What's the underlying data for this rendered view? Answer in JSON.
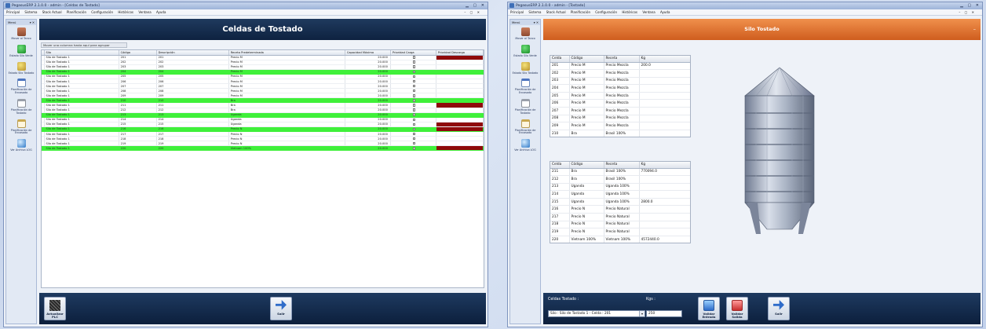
{
  "left_window": {
    "title": "PegasusERP 2.1.0.0 - admin - [Celdas de Tostado]",
    "menu": [
      "Principal",
      "Sistema",
      "Stock Actual",
      "Planificación",
      "Configuración",
      "Históricos",
      "Ventana",
      "Ayuda"
    ],
    "page_title": "Celdas de Tostado",
    "group_hint": "Mover una columna hasta aquí para agrupar",
    "columns": [
      "Silo",
      "Código",
      "Descripción",
      "Receta Predeterminada",
      "Capacidad Máxima",
      "Prioridad Carga",
      "Prioridad Descarga"
    ],
    "rows": [
      {
        "silo": "Silo de Tostado 1",
        "codigo": "201",
        "descripcion": "201",
        "receta": "Precio M",
        "cap": "20.000",
        "hl": false,
        "red": true
      },
      {
        "silo": "Silo de Tostado 1",
        "codigo": "202",
        "descripcion": "202",
        "receta": "Precio M",
        "cap": "20.000",
        "hl": false,
        "red": false
      },
      {
        "silo": "Silo de Tostado 1",
        "codigo": "203",
        "descripcion": "203",
        "receta": "Precio M",
        "cap": "20.000",
        "hl": false,
        "red": false
      },
      {
        "silo": "Silo de Tostado 1",
        "codigo": "204",
        "descripcion": "204",
        "receta": "Precio M",
        "cap": "20.000",
        "hl": true,
        "red": false
      },
      {
        "silo": "Silo de Tostado 1",
        "codigo": "205",
        "descripcion": "205",
        "receta": "Precio M",
        "cap": "20.000",
        "hl": false,
        "red": false
      },
      {
        "silo": "Silo de Tostado 1",
        "codigo": "206",
        "descripcion": "206",
        "receta": "Precio M",
        "cap": "20.000",
        "hl": false,
        "red": false
      },
      {
        "silo": "Silo de Tostado 1",
        "codigo": "207",
        "descripcion": "207",
        "receta": "Precio M",
        "cap": "20.000",
        "hl": false,
        "red": false
      },
      {
        "silo": "Silo de Tostado 1",
        "codigo": "208",
        "descripcion": "208",
        "receta": "Precio M",
        "cap": "20.000",
        "hl": false,
        "red": false
      },
      {
        "silo": "Silo de Tostado 1",
        "codigo": "209",
        "descripcion": "209",
        "receta": "Precio M",
        "cap": "20.000",
        "hl": false,
        "red": false
      },
      {
        "silo": "Silo de Tostado 1",
        "codigo": "210",
        "descripcion": "210",
        "receta": "Bra",
        "cap": "20.000",
        "hl": true,
        "red": false
      },
      {
        "silo": "Silo de Tostado 1",
        "codigo": "211",
        "descripcion": "211",
        "receta": "Bra",
        "cap": "20.000",
        "hl": false,
        "red": true
      },
      {
        "silo": "Silo de Tostado 1",
        "codigo": "212",
        "descripcion": "212",
        "receta": "Bra",
        "cap": "20.000",
        "hl": false,
        "red": false
      },
      {
        "silo": "Silo de Tostado 1",
        "codigo": "213",
        "descripcion": "213",
        "receta": "Uganda",
        "cap": "20.000",
        "hl": true,
        "red": false
      },
      {
        "silo": "Silo de Tostado 1",
        "codigo": "214",
        "descripcion": "214",
        "receta": "Uganda",
        "cap": "20.000",
        "hl": false,
        "red": false
      },
      {
        "silo": "Silo de Tostado 1",
        "codigo": "215",
        "descripcion": "215",
        "receta": "Uganda",
        "cap": "20.000",
        "hl": false,
        "red": true
      },
      {
        "silo": "Silo de Tostado 1",
        "codigo": "216",
        "descripcion": "216",
        "receta": "Precio N",
        "cap": "20.000",
        "hl": true,
        "red": true
      },
      {
        "silo": "Silo de Tostado 1",
        "codigo": "217",
        "descripcion": "217",
        "receta": "Precio N",
        "cap": "20.000",
        "hl": false,
        "red": false
      },
      {
        "silo": "Silo de Tostado 1",
        "codigo": "218",
        "descripcion": "218",
        "receta": "Precio N",
        "cap": "20.000",
        "hl": false,
        "red": false
      },
      {
        "silo": "Silo de Tostado 1",
        "codigo": "219",
        "descripcion": "219",
        "receta": "Precio N",
        "cap": "20.000",
        "hl": false,
        "red": false
      },
      {
        "silo": "Silo de Tostado 1",
        "codigo": "220",
        "descripcion": "220",
        "receta": "Vietnam 100%",
        "cap": "20.000",
        "hl": true,
        "red": true
      }
    ],
    "footer_buttons": {
      "plc": "Actualizar PLC",
      "exit": "Salir"
    }
  },
  "right_window": {
    "title": "PegasusERP 2.1.0.0 - admin - [Tostado]",
    "menu": [
      "Principal",
      "Sistema",
      "Stock Actual",
      "Planificación",
      "Configuración",
      "Históricos",
      "Ventana",
      "Ayuda"
    ],
    "page_title": "Silo Tostado",
    "table_columns": [
      "Celda",
      "Código",
      "Receta",
      "Kg"
    ],
    "table1": [
      [
        "201",
        "Precio M",
        "Precio Mezcla",
        "200.0"
      ],
      [
        "202",
        "Precio M",
        "Precio Mezcla",
        ""
      ],
      [
        "203",
        "Precio M",
        "Precio Mezcla",
        ""
      ],
      [
        "204",
        "Precio M",
        "Precio Mezcla",
        ""
      ],
      [
        "205",
        "Precio M",
        "Precio Mezcla",
        ""
      ],
      [
        "206",
        "Precio M",
        "Precio Mezcla",
        ""
      ],
      [
        "207",
        "Precio M",
        "Precio Mezcla",
        ""
      ],
      [
        "208",
        "Precio M",
        "Precio Mezcla",
        ""
      ],
      [
        "209",
        "Precio M",
        "Precio Mezcla",
        ""
      ],
      [
        "210",
        "Bra",
        "Brasil 100%",
        ""
      ]
    ],
    "table2": [
      [
        "211",
        "Bra",
        "Brasil 100%",
        "770094.0"
      ],
      [
        "212",
        "Bra",
        "Brasil 100%",
        ""
      ],
      [
        "213",
        "Uganda",
        "Uganda 100%",
        ""
      ],
      [
        "214",
        "Uganda",
        "Uganda 100%",
        ""
      ],
      [
        "215",
        "Uganda",
        "Uganda 100%",
        "2800.0"
      ],
      [
        "216",
        "Precio N",
        "Precio Natural",
        ""
      ],
      [
        "217",
        "Precio N",
        "Precio Natural",
        ""
      ],
      [
        "218",
        "Precio N",
        "Precio Natural",
        ""
      ],
      [
        "219",
        "Precio N",
        "Precio Natural",
        ""
      ],
      [
        "220",
        "Vietnam 100%",
        "Vietnam 100%",
        "4572440.0"
      ]
    ],
    "celda_label": "Celdas Tostado :",
    "celda_value": "Silo : Silo de Tostado 1 - Celda : 201",
    "kgs_label": "Kgs :",
    "kgs_value": "250",
    "buttons": {
      "entrada": "Validar Entrada",
      "salida": "Validar Salida",
      "exit": "Salir"
    }
  },
  "sidebar": {
    "head": "Menú",
    "items": [
      {
        "label": "Mover al Tanco",
        "icon": "bag-icon"
      },
      {
        "label": "Estado Silo Verde",
        "icon": "green-shield-icon"
      },
      {
        "label": "Estado Silo Tostado",
        "icon": "yellow-shield-icon"
      },
      {
        "label": "Planificación de Envasado",
        "icon": "calendar-icon"
      },
      {
        "label": "Planificación de Tostado",
        "icon": "calendar-grey-icon"
      },
      {
        "label": "Planificación de Envasado",
        "icon": "calendar-gold-icon"
      },
      {
        "label": "Ver Archivo LOG",
        "icon": "globe-icon"
      }
    ]
  },
  "colors": {
    "highlight_row": "#3ff03a",
    "priority_red": "#8f0a0a",
    "header_navy": "#0e2240",
    "header_orange": "#cf5d1e"
  }
}
